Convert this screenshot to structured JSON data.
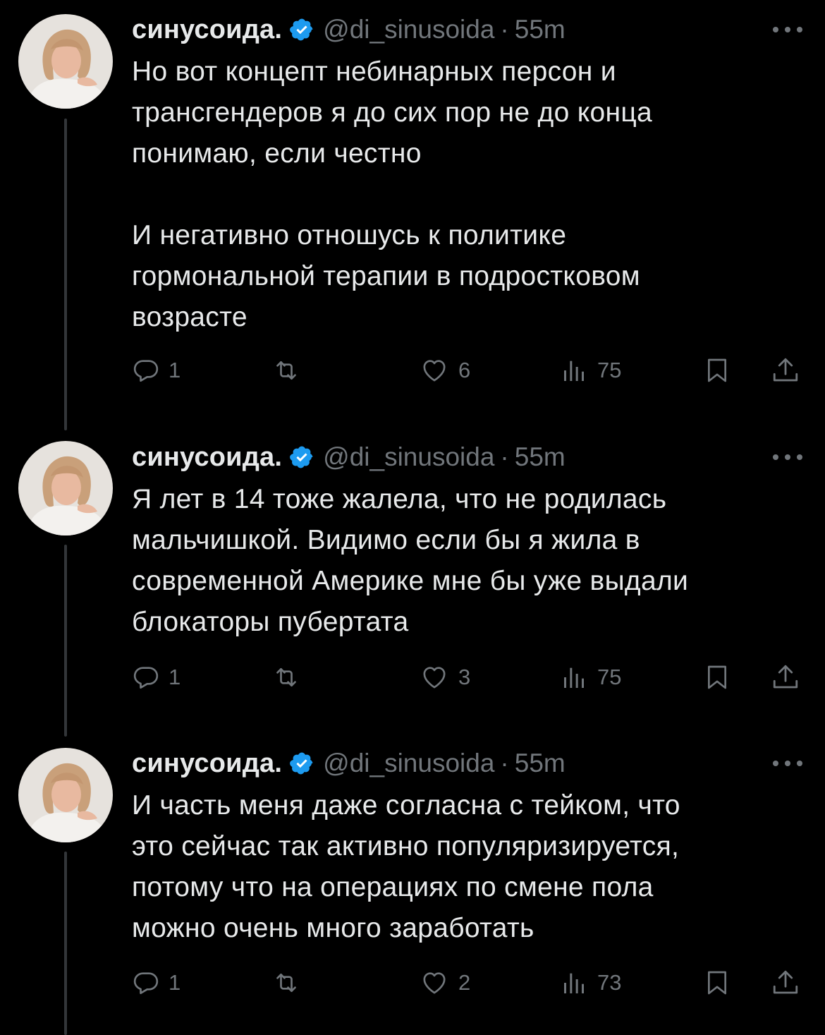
{
  "colors": {
    "background": "#000000",
    "text": "#e7e9ea",
    "secondary": "#71767b",
    "verified": "#1d9bf0",
    "thread_line": "#333639"
  },
  "tweets": [
    {
      "name": "синусоида.",
      "handle": "@di_sinusoida",
      "dot": "·",
      "time": "55m",
      "text": "Но вот концепт небинарных персон и\nтрансгендеров я до сих пор не до конца\nпонимаю, если честно\n\nИ негативно отношусь к политике\nгормональной терапии в подростковом\nвозрасте",
      "replies": "1",
      "retweets": "",
      "likes": "6",
      "views": "75"
    },
    {
      "name": "синусоида.",
      "handle": "@di_sinusoida",
      "dot": "·",
      "time": "55m",
      "text": "Я лет в 14 тоже жалела, что не родилась\nмальчишкой. Видимо если бы я жила в\nсовременной Америке мне бы уже выдали\nблокаторы пубертата",
      "replies": "1",
      "retweets": "",
      "likes": "3",
      "views": "75"
    },
    {
      "name": "синусоида.",
      "handle": "@di_sinusoida",
      "dot": "·",
      "time": "55m",
      "text": "И часть меня даже согласна с тейком, что\nэто сейчас так активно популяризируется,\nпотому что на операциях по смене пола\nможно очень много заработать",
      "replies": "1",
      "retweets": "",
      "likes": "2",
      "views": "73"
    }
  ]
}
